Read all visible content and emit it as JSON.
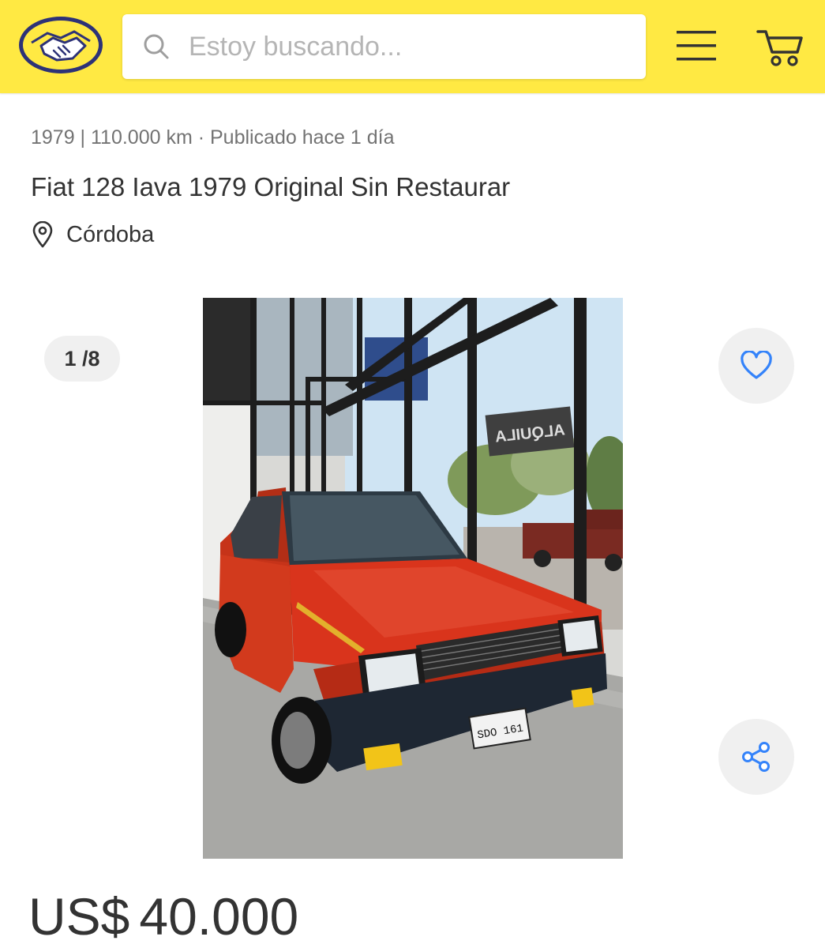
{
  "header": {
    "search_placeholder": "Estoy buscando..."
  },
  "listing": {
    "meta": "1979 | 110.000 km · Publicado hace 1 día",
    "title": "Fiat 128 Iava 1979 Original Sin Restaurar",
    "location": "Córdoba",
    "gallery_counter": "1 /8",
    "price_currency": "US$",
    "price_amount": "40.000",
    "plate_text": "SDO 161",
    "sign_text": "ALQUILA"
  },
  "colors": {
    "brand_yellow": "#ffe943",
    "brand_blue": "#2d3277",
    "accent_blue": "#3483fa",
    "car_red": "#d9341c"
  },
  "icons": {
    "logo": "handshake-logo",
    "search": "search-icon",
    "menu": "hamburger-menu-icon",
    "cart": "cart-icon",
    "location": "location-pin-icon",
    "favorite": "heart-icon",
    "share": "share-icon"
  }
}
